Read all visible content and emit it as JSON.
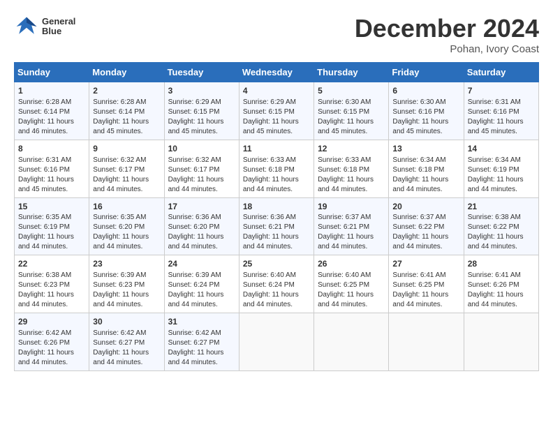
{
  "logo": {
    "line1": "General",
    "line2": "Blue"
  },
  "title": "December 2024",
  "location": "Pohan, Ivory Coast",
  "weekdays": [
    "Sunday",
    "Monday",
    "Tuesday",
    "Wednesday",
    "Thursday",
    "Friday",
    "Saturday"
  ],
  "weeks": [
    [
      {
        "day": "1",
        "info": "Sunrise: 6:28 AM\nSunset: 6:14 PM\nDaylight: 11 hours\nand 46 minutes."
      },
      {
        "day": "2",
        "info": "Sunrise: 6:28 AM\nSunset: 6:14 PM\nDaylight: 11 hours\nand 45 minutes."
      },
      {
        "day": "3",
        "info": "Sunrise: 6:29 AM\nSunset: 6:15 PM\nDaylight: 11 hours\nand 45 minutes."
      },
      {
        "day": "4",
        "info": "Sunrise: 6:29 AM\nSunset: 6:15 PM\nDaylight: 11 hours\nand 45 minutes."
      },
      {
        "day": "5",
        "info": "Sunrise: 6:30 AM\nSunset: 6:15 PM\nDaylight: 11 hours\nand 45 minutes."
      },
      {
        "day": "6",
        "info": "Sunrise: 6:30 AM\nSunset: 6:16 PM\nDaylight: 11 hours\nand 45 minutes."
      },
      {
        "day": "7",
        "info": "Sunrise: 6:31 AM\nSunset: 6:16 PM\nDaylight: 11 hours\nand 45 minutes."
      }
    ],
    [
      {
        "day": "8",
        "info": "Sunrise: 6:31 AM\nSunset: 6:16 PM\nDaylight: 11 hours\nand 45 minutes."
      },
      {
        "day": "9",
        "info": "Sunrise: 6:32 AM\nSunset: 6:17 PM\nDaylight: 11 hours\nand 44 minutes."
      },
      {
        "day": "10",
        "info": "Sunrise: 6:32 AM\nSunset: 6:17 PM\nDaylight: 11 hours\nand 44 minutes."
      },
      {
        "day": "11",
        "info": "Sunrise: 6:33 AM\nSunset: 6:18 PM\nDaylight: 11 hours\nand 44 minutes."
      },
      {
        "day": "12",
        "info": "Sunrise: 6:33 AM\nSunset: 6:18 PM\nDaylight: 11 hours\nand 44 minutes."
      },
      {
        "day": "13",
        "info": "Sunrise: 6:34 AM\nSunset: 6:18 PM\nDaylight: 11 hours\nand 44 minutes."
      },
      {
        "day": "14",
        "info": "Sunrise: 6:34 AM\nSunset: 6:19 PM\nDaylight: 11 hours\nand 44 minutes."
      }
    ],
    [
      {
        "day": "15",
        "info": "Sunrise: 6:35 AM\nSunset: 6:19 PM\nDaylight: 11 hours\nand 44 minutes."
      },
      {
        "day": "16",
        "info": "Sunrise: 6:35 AM\nSunset: 6:20 PM\nDaylight: 11 hours\nand 44 minutes."
      },
      {
        "day": "17",
        "info": "Sunrise: 6:36 AM\nSunset: 6:20 PM\nDaylight: 11 hours\nand 44 minutes."
      },
      {
        "day": "18",
        "info": "Sunrise: 6:36 AM\nSunset: 6:21 PM\nDaylight: 11 hours\nand 44 minutes."
      },
      {
        "day": "19",
        "info": "Sunrise: 6:37 AM\nSunset: 6:21 PM\nDaylight: 11 hours\nand 44 minutes."
      },
      {
        "day": "20",
        "info": "Sunrise: 6:37 AM\nSunset: 6:22 PM\nDaylight: 11 hours\nand 44 minutes."
      },
      {
        "day": "21",
        "info": "Sunrise: 6:38 AM\nSunset: 6:22 PM\nDaylight: 11 hours\nand 44 minutes."
      }
    ],
    [
      {
        "day": "22",
        "info": "Sunrise: 6:38 AM\nSunset: 6:23 PM\nDaylight: 11 hours\nand 44 minutes."
      },
      {
        "day": "23",
        "info": "Sunrise: 6:39 AM\nSunset: 6:23 PM\nDaylight: 11 hours\nand 44 minutes."
      },
      {
        "day": "24",
        "info": "Sunrise: 6:39 AM\nSunset: 6:24 PM\nDaylight: 11 hours\nand 44 minutes."
      },
      {
        "day": "25",
        "info": "Sunrise: 6:40 AM\nSunset: 6:24 PM\nDaylight: 11 hours\nand 44 minutes."
      },
      {
        "day": "26",
        "info": "Sunrise: 6:40 AM\nSunset: 6:25 PM\nDaylight: 11 hours\nand 44 minutes."
      },
      {
        "day": "27",
        "info": "Sunrise: 6:41 AM\nSunset: 6:25 PM\nDaylight: 11 hours\nand 44 minutes."
      },
      {
        "day": "28",
        "info": "Sunrise: 6:41 AM\nSunset: 6:26 PM\nDaylight: 11 hours\nand 44 minutes."
      }
    ],
    [
      {
        "day": "29",
        "info": "Sunrise: 6:42 AM\nSunset: 6:26 PM\nDaylight: 11 hours\nand 44 minutes."
      },
      {
        "day": "30",
        "info": "Sunrise: 6:42 AM\nSunset: 6:27 PM\nDaylight: 11 hours\nand 44 minutes."
      },
      {
        "day": "31",
        "info": "Sunrise: 6:42 AM\nSunset: 6:27 PM\nDaylight: 11 hours\nand 44 minutes."
      },
      {
        "day": "",
        "info": ""
      },
      {
        "day": "",
        "info": ""
      },
      {
        "day": "",
        "info": ""
      },
      {
        "day": "",
        "info": ""
      }
    ]
  ]
}
